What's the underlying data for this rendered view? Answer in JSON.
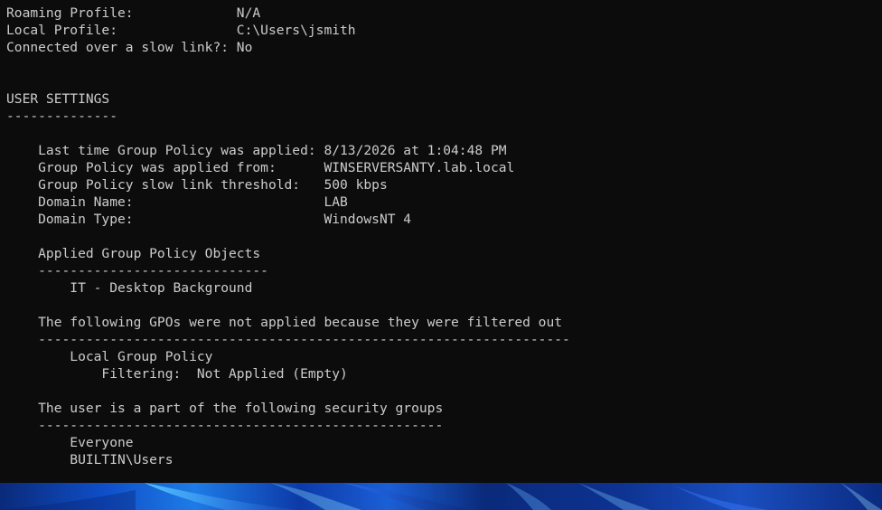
{
  "console": {
    "lines": [
      "Roaming Profile:             N/A",
      "Local Profile:               C:\\Users\\jsmith",
      "Connected over a slow link?: No",
      "",
      "",
      "USER SETTINGS",
      "--------------",
      "",
      "    Last time Group Policy was applied: 8/13/2026 at 1:04:48 PM",
      "    Group Policy was applied from:      WINSERVERSANTY.lab.local",
      "    Group Policy slow link threshold:   500 kbps",
      "    Domain Name:                        LAB",
      "    Domain Type:                        WindowsNT 4",
      "",
      "    Applied Group Policy Objects",
      "    -----------------------------",
      "        IT - Desktop Background",
      "",
      "    The following GPOs were not applied because they were filtered out",
      "    -------------------------------------------------------------------",
      "        Local Group Policy",
      "            Filtering:  Not Applied (Empty)",
      "",
      "    The user is a part of the following security groups",
      "    ---------------------------------------------------",
      "        Everyone",
      "        BUILTIN\\Users"
    ]
  },
  "colors": {
    "background": "#0c0c0c",
    "foreground": "#cccccc"
  }
}
